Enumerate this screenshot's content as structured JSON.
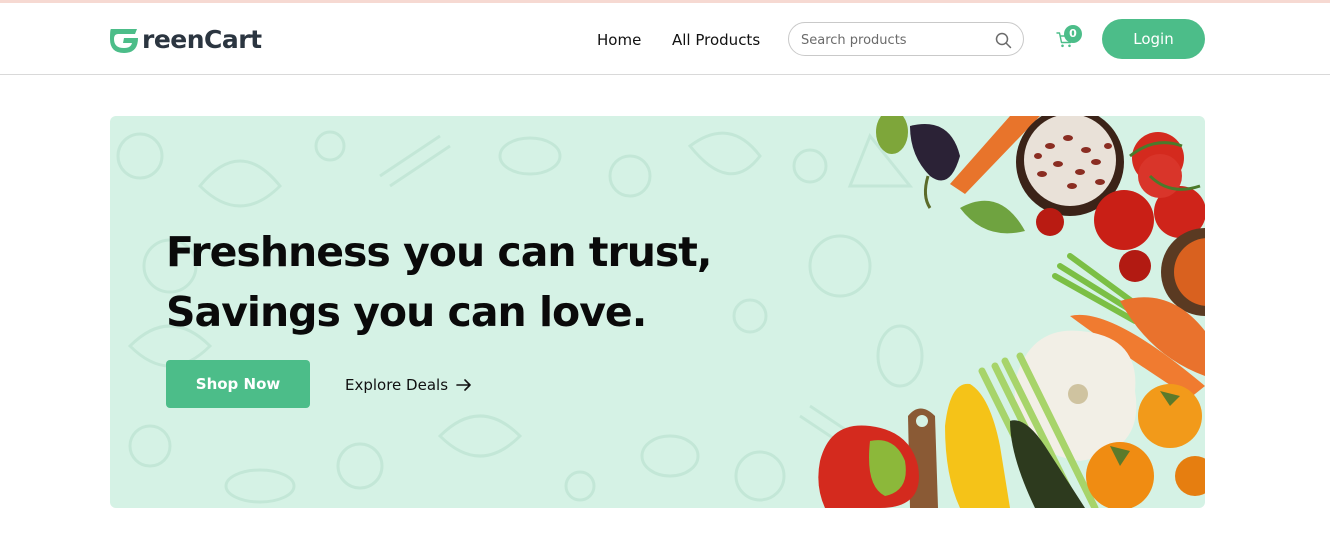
{
  "brand": {
    "name_rest": "reenCart",
    "accent_color": "#4cbd89",
    "text_color": "#2b3540"
  },
  "nav": {
    "home_label": "Home",
    "all_products_label": "All Products",
    "search": {
      "placeholder": "Search products",
      "value": ""
    },
    "cart_count": "0",
    "login_label": "Login"
  },
  "hero": {
    "title_line1": "Freshness you can trust,",
    "title_line2": "Savings you can love.",
    "shop_now_label": "Shop Now",
    "explore_label": "Explore Deals",
    "background_color": "#d5f2e5"
  },
  "icons": [
    "logo-g-icon",
    "search-icon",
    "cart-icon",
    "arrow-right-icon"
  ]
}
